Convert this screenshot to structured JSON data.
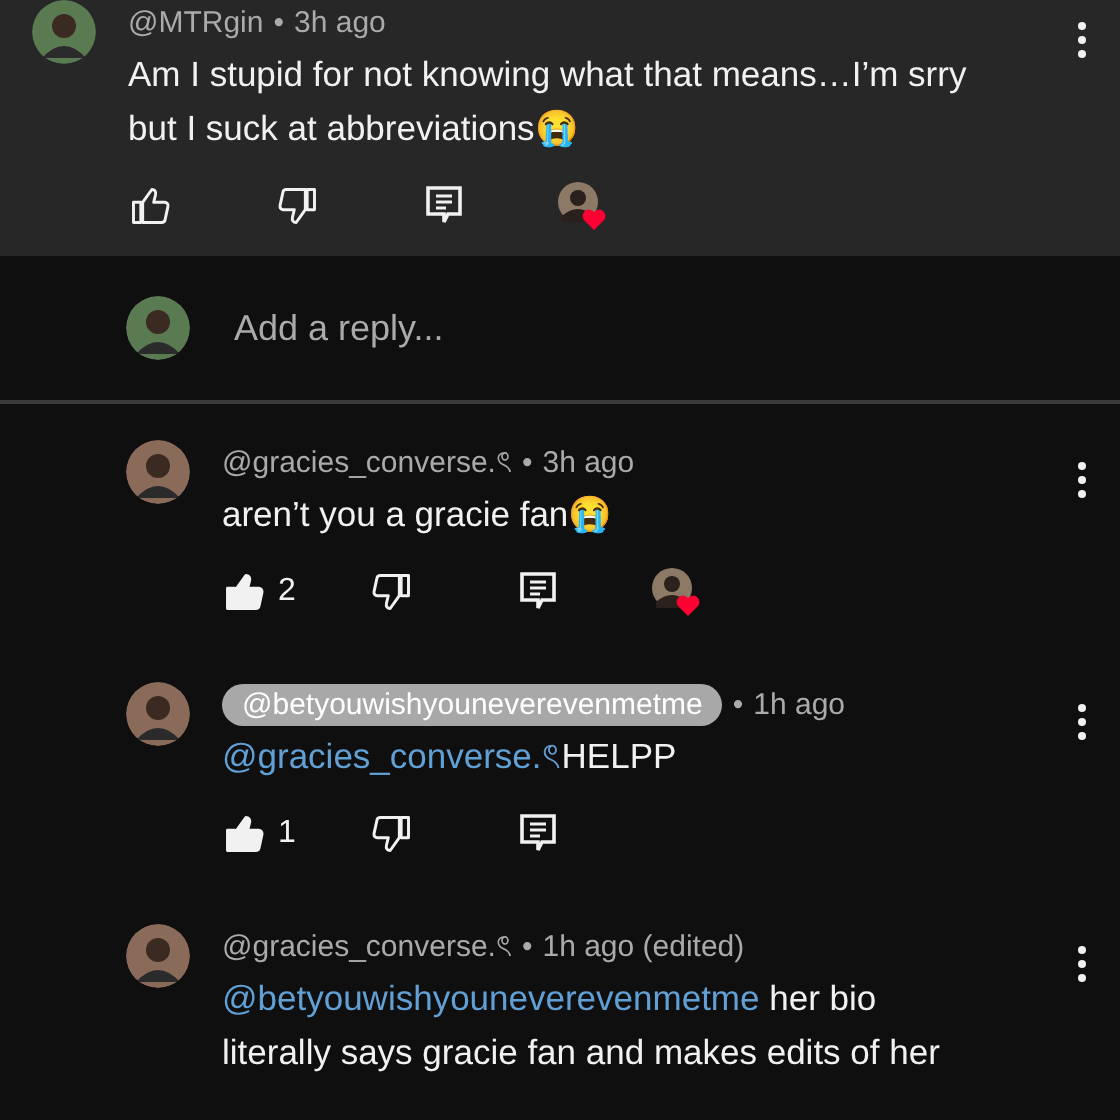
{
  "comment": {
    "author": "@MTRgin",
    "separator": "•",
    "time": "3h ago",
    "text": "Am I stupid for not knowing what that means…I’m srry but I suck at abbreviations😭",
    "hearted": true
  },
  "reply_box": {
    "placeholder": "Add a reply..."
  },
  "replies": [
    {
      "author": "@gracies_converse.ৎ",
      "highlighted": false,
      "separator": "•",
      "time": "3h ago",
      "text": "aren’t you a gracie fan😭",
      "likes": "2",
      "liked": true,
      "hearted": true
    },
    {
      "author": "@betyouwishyouneverevenmetme",
      "highlighted": true,
      "separator": "•",
      "time": "1h ago",
      "mention": "@gracies_converse.ৎ",
      "text": "HELPP",
      "likes": "1",
      "liked": true,
      "hearted": false
    },
    {
      "author": "@gracies_converse.ৎ",
      "highlighted": false,
      "separator": "•",
      "time": "1h ago (edited)",
      "mention": "@betyouwishyouneverevenmetme",
      "text": " her bio literally says gracie fan and makes edits of her"
    }
  ]
}
